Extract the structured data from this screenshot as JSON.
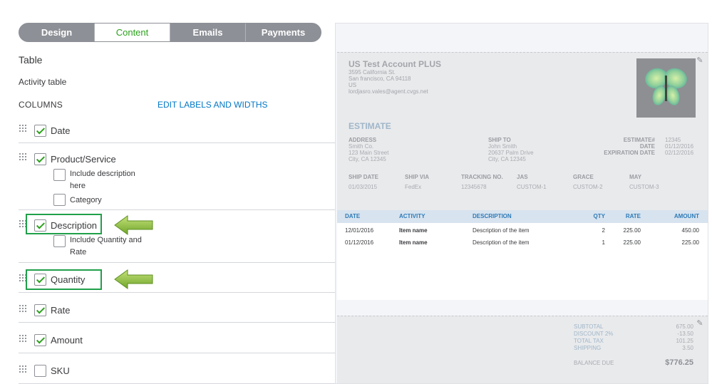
{
  "tabs": [
    {
      "label": "Design",
      "active": false
    },
    {
      "label": "Content",
      "active": true
    },
    {
      "label": "Emails",
      "active": false
    },
    {
      "label": "Payments",
      "active": false
    }
  ],
  "settings": {
    "section_title": "Table",
    "subtitle": "Activity table",
    "columns_label": "COLUMNS",
    "edit_link": "EDIT LABELS AND WIDTHS",
    "columns": [
      {
        "label": "Date",
        "checked": true
      },
      {
        "label": "Product/Service",
        "checked": true,
        "sub": [
          {
            "label": "Include description here",
            "checked": false
          },
          {
            "label": "Category",
            "checked": false
          }
        ]
      },
      {
        "label": "Description",
        "checked": true,
        "highlighted": true,
        "sub": [
          {
            "label": "Include Quantity and Rate",
            "checked": false
          }
        ]
      },
      {
        "label": "Quantity",
        "checked": true,
        "highlighted": true
      },
      {
        "label": "Rate",
        "checked": true
      },
      {
        "label": "Amount",
        "checked": true
      },
      {
        "label": "SKU",
        "checked": false
      }
    ]
  },
  "preview": {
    "company": {
      "name": "US Test Account PLUS",
      "lines": [
        "3595 California St.",
        "San francisco, CA 94118",
        "US",
        "lordjasro.vales@agent.cvgs.net"
      ]
    },
    "doc_title": "ESTIMATE",
    "address": {
      "label": "ADDRESS",
      "lines": [
        "Smith Co.",
        "123 Main Street",
        "City, CA 12345"
      ]
    },
    "ship_to": {
      "label": "SHIP TO",
      "lines": [
        "John Smith",
        "20637 Palm Drive",
        "City, CA 12345"
      ]
    },
    "meta": [
      {
        "label": "ESTIMATE#",
        "value": "12345"
      },
      {
        "label": "DATE",
        "value": "01/12/2016"
      },
      {
        "label": "EXPIRATION DATE",
        "value": "02/12/2016"
      }
    ],
    "shipping_fields": [
      {
        "label": "SHIP DATE",
        "value": "01/03/2015"
      },
      {
        "label": "SHIP VIA",
        "value": "FedEx"
      },
      {
        "label": "TRACKING NO.",
        "value": "12345678"
      },
      {
        "label": "JAS",
        "value": "CUSTOM-1"
      },
      {
        "label": "GRACE",
        "value": "CUSTOM-2"
      },
      {
        "label": "MAY",
        "value": "CUSTOM-3"
      }
    ],
    "table": {
      "headers": [
        "DATE",
        "ACTIVITY",
        "DESCRIPTION",
        "QTY",
        "RATE",
        "AMOUNT"
      ],
      "rows": [
        [
          "12/01/2016",
          "Item name",
          "Description of the item",
          "2",
          "225.00",
          "450.00"
        ],
        [
          "01/12/2016",
          "Item name",
          "Description of the item",
          "1",
          "225.00",
          "225.00"
        ]
      ]
    },
    "totals": [
      {
        "label": "SUBTOTAL",
        "value": "675.00"
      },
      {
        "label": "DISCOUNT 2%",
        "value": "-13.50"
      },
      {
        "label": "TOTAL TAX",
        "value": "101.25"
      },
      {
        "label": "SHIPPING",
        "value": "3.50"
      }
    ],
    "balance": {
      "label": "BALANCE DUE",
      "value": "$776.25"
    }
  },
  "colors": {
    "accent": "#2ca01c",
    "link": "#0077c5",
    "highlight_box": "#21a04a",
    "arrow": "#8dc63f"
  }
}
